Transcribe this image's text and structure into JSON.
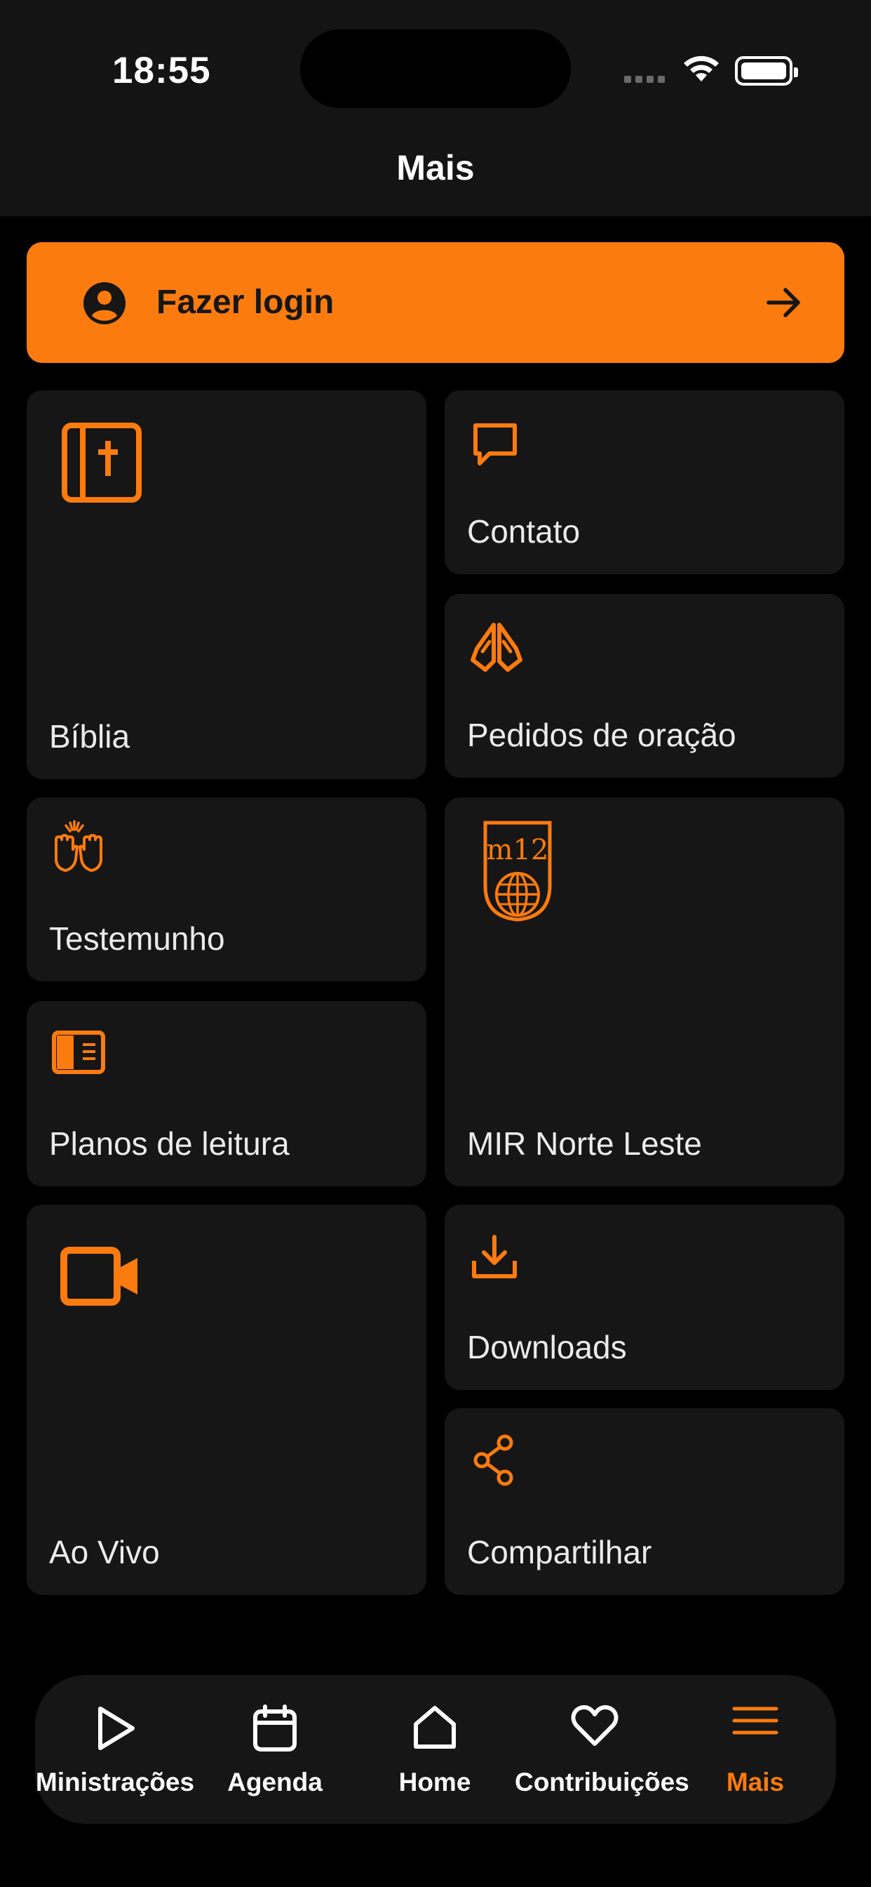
{
  "status_bar": {
    "time": "18:55"
  },
  "header": {
    "title": "Mais"
  },
  "login": {
    "label": "Fazer login"
  },
  "cards": {
    "biblia": "Bíblia",
    "contato": "Contato",
    "pedidos": "Pedidos de oração",
    "testemunho": "Testemunho",
    "mir": "MIR Norte Leste",
    "mir_logo_text": "m12",
    "planos": "Planos de leitura",
    "ao_vivo": "Ao Vivo",
    "downloads": "Downloads",
    "compartilhar": "Compartilhar"
  },
  "bottom_nav": {
    "items": [
      {
        "label": "Ministrações",
        "icon": "play-icon"
      },
      {
        "label": "Agenda",
        "icon": "calendar-icon"
      },
      {
        "label": "Home",
        "icon": "home-icon"
      },
      {
        "label": "Contribuições",
        "icon": "heart-icon"
      },
      {
        "label": "Mais",
        "icon": "menu-icon",
        "active": true
      }
    ]
  },
  "colors": {
    "accent": "#fb7b0f",
    "card_bg": "#161616",
    "header_bg": "#141414",
    "background": "#000000"
  }
}
